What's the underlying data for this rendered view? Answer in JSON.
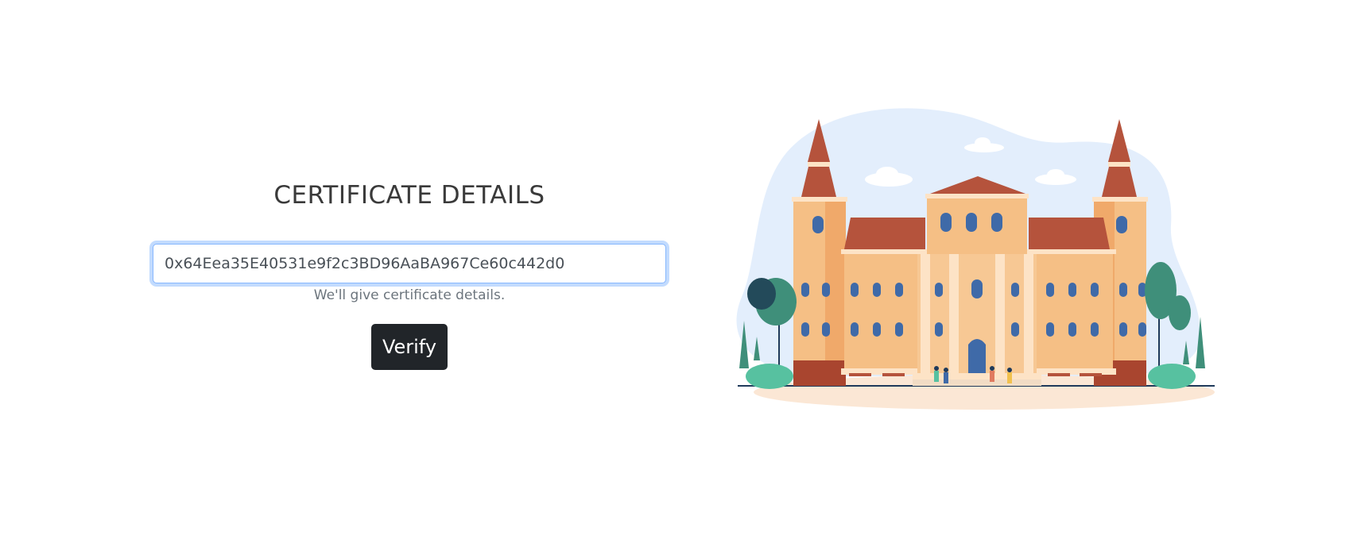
{
  "form": {
    "title": "CERTIFICATE DETAILS",
    "input_value": "0x64Eea35E40531e9f2c3BD96AaBA967Ce60c442d0",
    "help_text": "We'll give certificate details.",
    "verify_label": "Verify"
  },
  "colors": {
    "button_bg": "#212529",
    "focus_ring": "#86b7fe",
    "building_wall": "#f5bf85",
    "building_roof": "#b5533c",
    "window": "#3f6aa8",
    "tree": "#3f8f7a",
    "sky_blob": "#e3eefc"
  },
  "illustration": {
    "icon": "university-building-illustration"
  }
}
